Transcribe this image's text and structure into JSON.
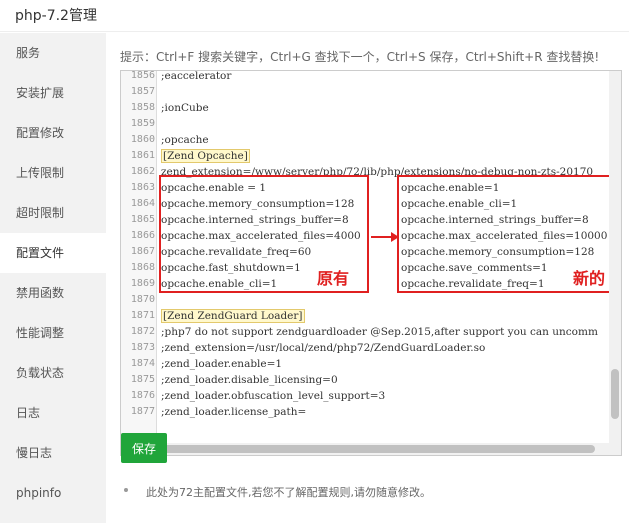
{
  "window": {
    "title": "php-7.2管理"
  },
  "sidebar": {
    "items": [
      {
        "label": "服务",
        "active": false
      },
      {
        "label": "安装扩展",
        "active": false
      },
      {
        "label": "配置修改",
        "active": false
      },
      {
        "label": "上传限制",
        "active": false
      },
      {
        "label": "超时限制",
        "active": false
      },
      {
        "label": "配置文件",
        "active": true
      },
      {
        "label": "禁用函数",
        "active": false
      },
      {
        "label": "性能调整",
        "active": false
      },
      {
        "label": "负载状态",
        "active": false
      },
      {
        "label": "日志",
        "active": false
      },
      {
        "label": "慢日志",
        "active": false
      },
      {
        "label": "phpinfo",
        "active": false
      }
    ]
  },
  "main": {
    "tip": "提示：Ctrl+F 搜索关键字，Ctrl+G 查找下一个，Ctrl+S 保存，Ctrl+Shift+R 查找替换!",
    "save_label": "保存",
    "note": "此处为72主配置文件,若您不了解配置规则,请勿随意修改。"
  },
  "editor": {
    "lines": [
      {
        "no": "1856",
        "text": ";eaccelerator"
      },
      {
        "no": "1857",
        "text": ""
      },
      {
        "no": "1858",
        "text": ";ionCube"
      },
      {
        "no": "1859",
        "text": ""
      },
      {
        "no": "1860",
        "text": ";opcache"
      },
      {
        "no": "1861",
        "text": "[Zend Opcache]"
      },
      {
        "no": "1862",
        "text": "zend_extension=/www/server/php/72/lib/php/extensions/no-debug-non-zts-20170"
      },
      {
        "no": "1863",
        "text": "opcache.enable = 1"
      },
      {
        "no": "1864",
        "text": "opcache.memory_consumption=128"
      },
      {
        "no": "1865",
        "text": "opcache.interned_strings_buffer=8"
      },
      {
        "no": "1866",
        "text": "opcache.max_accelerated_files=4000"
      },
      {
        "no": "1867",
        "text": "opcache.revalidate_freq=60"
      },
      {
        "no": "1868",
        "text": "opcache.fast_shutdown=1"
      },
      {
        "no": "1869",
        "text": "opcache.enable_cli=1"
      },
      {
        "no": "1870",
        "text": ""
      },
      {
        "no": "1871",
        "text": "[Zend ZendGuard Loader]"
      },
      {
        "no": "1872",
        "text": ";php7 do not support zendguardloader @Sep.2015,after support you can uncomm"
      },
      {
        "no": "1873",
        "text": ";zend_extension=/usr/local/zend/php72/ZendGuardLoader.so"
      },
      {
        "no": "1874",
        "text": ";zend_loader.enable=1"
      },
      {
        "no": "1875",
        "text": ";zend_loader.disable_licensing=0"
      },
      {
        "no": "1876",
        "text": ";zend_loader.obfuscation_level_support=3"
      },
      {
        "no": "1877",
        "text": ";zend_loader.license_path="
      }
    ],
    "new_config": [
      "opcache.enable=1",
      "opcache.enable_cli=1",
      "opcache.interned_strings_buffer=8",
      "opcache.max_accelerated_files=10000",
      "opcache.memory_consumption=128",
      "opcache.save_comments=1",
      "opcache.revalidate_freq=1"
    ],
    "annotation_original": "原有",
    "annotation_new": "新的",
    "annotation_color": "#e02020"
  }
}
